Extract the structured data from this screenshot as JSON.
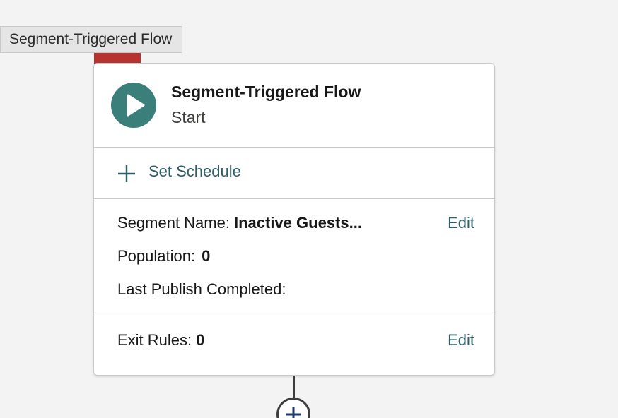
{
  "tooltip": {
    "text": "Segment-Triggered Flow"
  },
  "start_node": {
    "title": "Segment-Triggered Flow",
    "subtitle": "Start",
    "icon": "play-icon",
    "icon_color": "#3b7f7a",
    "schedule": {
      "icon": "plus-icon",
      "label": "Set Schedule"
    },
    "segment_name": {
      "label": "Segment Name:",
      "value": "Inactive Guests...",
      "edit_label": "Edit"
    },
    "population": {
      "label": "Population:",
      "value": "0"
    },
    "last_publish": {
      "label": "Last Publish Completed:",
      "value": ""
    },
    "exit_rules": {
      "label": "Exit Rules:",
      "value": "0",
      "edit_label": "Edit"
    }
  },
  "add_element": {
    "icon": "plus-icon"
  },
  "colors": {
    "accent_link": "#2e5e6a",
    "marker_red": "#b83330",
    "canvas_bg": "#f3f3f3"
  }
}
